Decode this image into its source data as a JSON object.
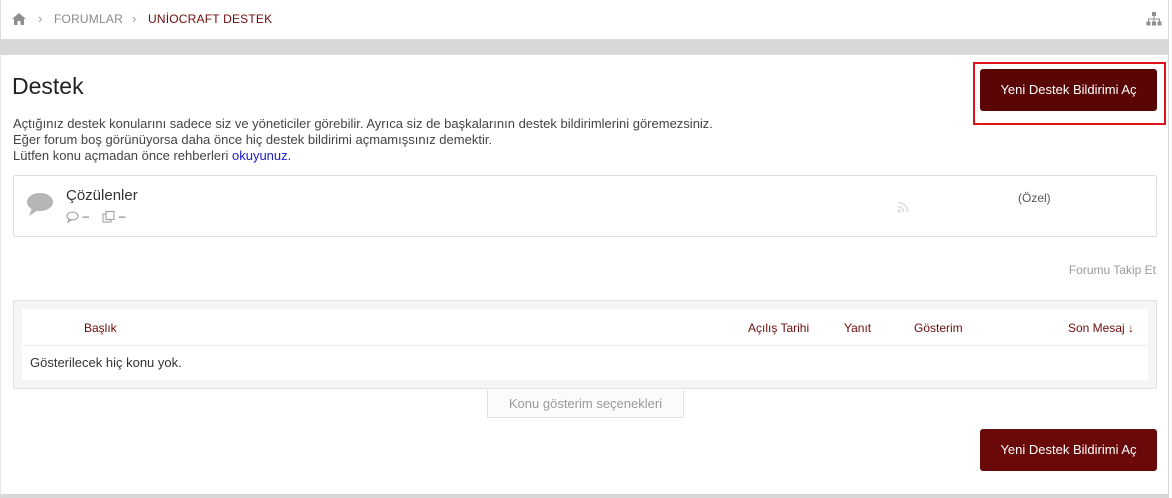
{
  "breadcrumb": {
    "items": [
      "FORUMLAR",
      "UNİOCRAFT DESTEK"
    ],
    "icons": [
      "home-icon",
      "sitemap-icon"
    ]
  },
  "page": {
    "title": "Destek",
    "new_ticket_label": "Yeni Destek Bildirimi Aç",
    "description": {
      "line1": "Açtığınız destek konularını sadece siz ve yöneticiler görebilir. Ayrıca siz de başkalarının destek bildirimlerini göremezsiniz.",
      "line2": "Eğer forum boş görünüyorsa daha önce hiç destek bildirimi açmamışsınız demektir.",
      "line3_prefix": "Lütfen konu açmadan önce rehberleri ",
      "line3_link": "okuyunuz."
    }
  },
  "subforum": {
    "name": "Çözülenler",
    "threads": "–",
    "messages": "–",
    "visibility": "(Özel)"
  },
  "follow_label": "Forumu Takip Et",
  "threads_table": {
    "columns": [
      "Başlık",
      "Açılış Tarihi",
      "Yanıt",
      "Gösterim",
      "Son Mesaj ↓"
    ],
    "empty_text": "Gösterilecek hiç konu yok."
  },
  "view_options_label": "Konu gösterim seçenekleri",
  "colors": {
    "accent": "#5a0606",
    "link": "#1a1acc",
    "highlight_frame": "#e0111b"
  }
}
